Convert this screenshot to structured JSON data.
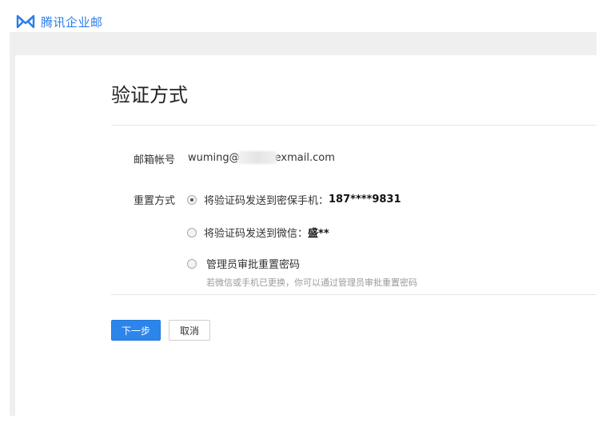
{
  "header": {
    "logo_text": "腾讯企业邮",
    "logo_icon": "tencent-exmail-logo-icon",
    "brand_color": "#2b7de9"
  },
  "page": {
    "title": "验证方式"
  },
  "form": {
    "email_label": "邮箱帐号",
    "email_prefix": "wuming@",
    "email_suffix": "exmail.com",
    "reset_label": "重置方式",
    "options": [
      {
        "text": "将验证码发送到密保手机：",
        "value": "187****9831",
        "selected": true
      },
      {
        "text": "将验证码发送到微信：",
        "value": "盛**",
        "selected": false
      },
      {
        "text": "管理员审批重置密码",
        "selected": false,
        "hint": "若微信或手机已更换，你可以通过管理员审批重置密码"
      }
    ]
  },
  "actions": {
    "next_label": "下一步",
    "cancel_label": "取消",
    "primary_color": "#2c85eb"
  }
}
